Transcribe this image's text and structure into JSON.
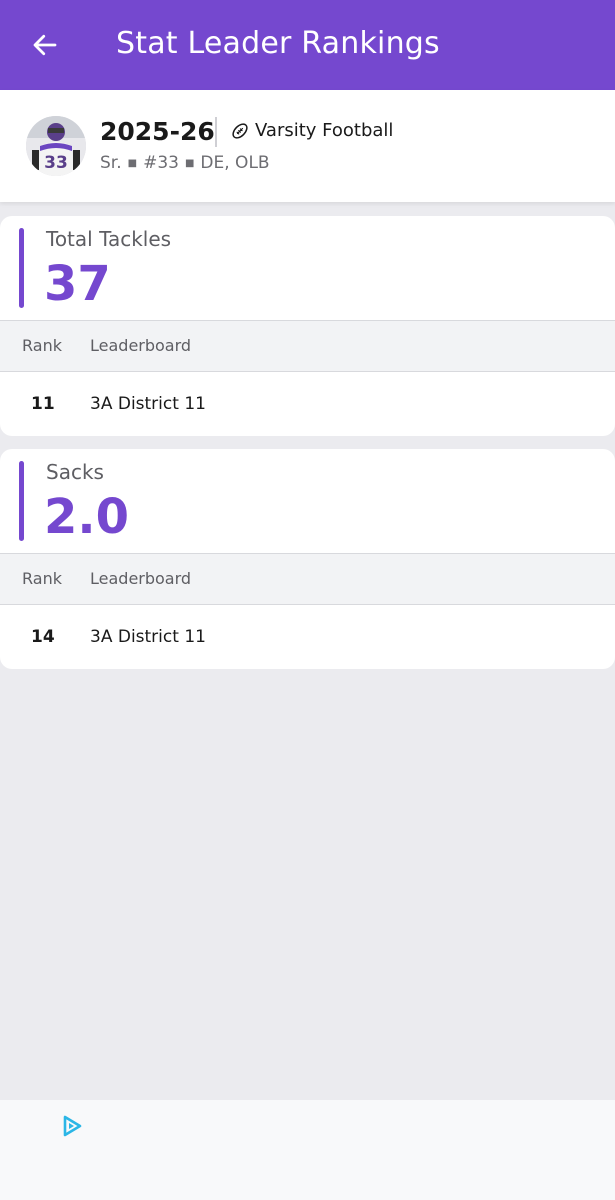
{
  "appbar": {
    "title": "Stat Leader Rankings"
  },
  "profile": {
    "season": "2025-26",
    "sport": "Varsity Football",
    "class_year": "Sr.",
    "number": "#33",
    "positions": "DE, OLB",
    "jersey_number": "33"
  },
  "stats": [
    {
      "title": "Total Tackles",
      "value": "37",
      "col_rank": "Rank",
      "col_board": "Leaderboard",
      "rows": [
        {
          "rank": "11",
          "board": "3A District 11"
        }
      ]
    },
    {
      "title": "Sacks",
      "value": "2.0",
      "col_rank": "Rank",
      "col_board": "Leaderboard",
      "rows": [
        {
          "rank": "14",
          "board": "3A District 11"
        }
      ]
    }
  ],
  "colors": {
    "accent": "#7548cf",
    "background": "#ebebef",
    "ad_icon": "#2bb6e6"
  },
  "icons": {
    "back": "arrow-left-icon",
    "sport": "football-icon",
    "ad": "ad-choices-icon"
  }
}
